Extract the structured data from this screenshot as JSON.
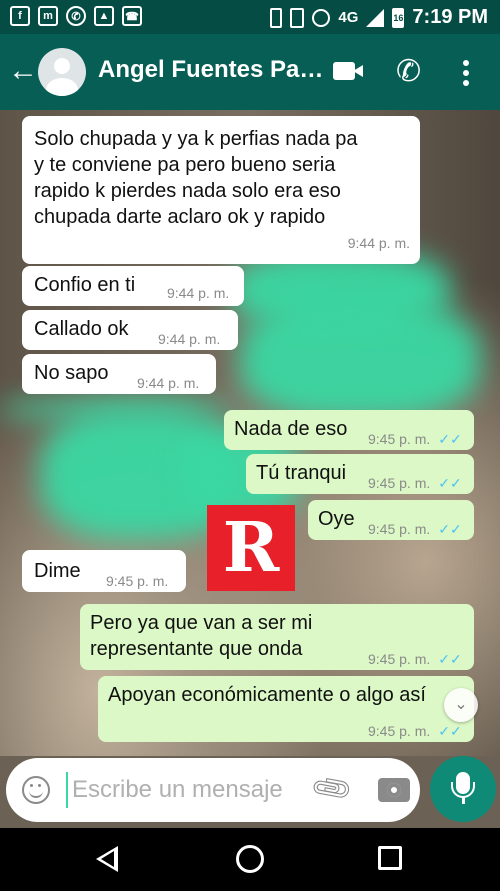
{
  "status_bar": {
    "icons": [
      "facebook-icon",
      "messenger-icon",
      "whatsapp-icon",
      "gallery-icon",
      "phone-icon"
    ],
    "network": "4G",
    "battery": "16",
    "time": "7:19 PM"
  },
  "header": {
    "contact_name": "Angel Fuentes Pa…"
  },
  "messages": [
    {
      "direction": "in",
      "text": "Solo chupada y ya k perfias nada pa\ny te conviene pa pero bueno seria\nrapido k pierdes nada solo era eso\nchupada darte aclaro ok y rapido",
      "time": "9:44 p. m."
    },
    {
      "direction": "in",
      "text": "Confio en ti",
      "time": "9:44 p. m."
    },
    {
      "direction": "in",
      "text": "Callado ok",
      "time": "9:44 p. m."
    },
    {
      "direction": "in",
      "text": "No sapo",
      "time": "9:44 p. m."
    },
    {
      "direction": "out",
      "text": "Nada de eso",
      "time": "9:45 p. m.",
      "ticks": "✓✓"
    },
    {
      "direction": "out",
      "text": "Tú tranqui",
      "time": "9:45 p. m.",
      "ticks": "✓✓"
    },
    {
      "direction": "out",
      "text": "Oye",
      "time": "9:45 p. m.",
      "ticks": "✓✓"
    },
    {
      "direction": "in",
      "text": "Dime",
      "time": "9:45 p. m."
    },
    {
      "direction": "out",
      "text": "Pero ya que van a ser mi\nrepresentante que onda",
      "time": "9:45 p. m.",
      "ticks": "✓✓"
    },
    {
      "direction": "out",
      "text": "Apoyan económicamente o algo así",
      "time": "9:45 p. m.",
      "ticks": "✓✓"
    }
  ],
  "watermark": "R",
  "composer": {
    "placeholder": "Escribe un mensaje"
  },
  "colors": {
    "status_bar": "#054d44",
    "app_bar": "#075e54",
    "incoming_bubble": "#ffffff",
    "outgoing_bubble": "#dcf8c6",
    "read_ticks": "#4fc3f7",
    "mic_button": "#0e8a76",
    "censor_blur": "#3ad8a3",
    "watermark": "#e8202a"
  }
}
